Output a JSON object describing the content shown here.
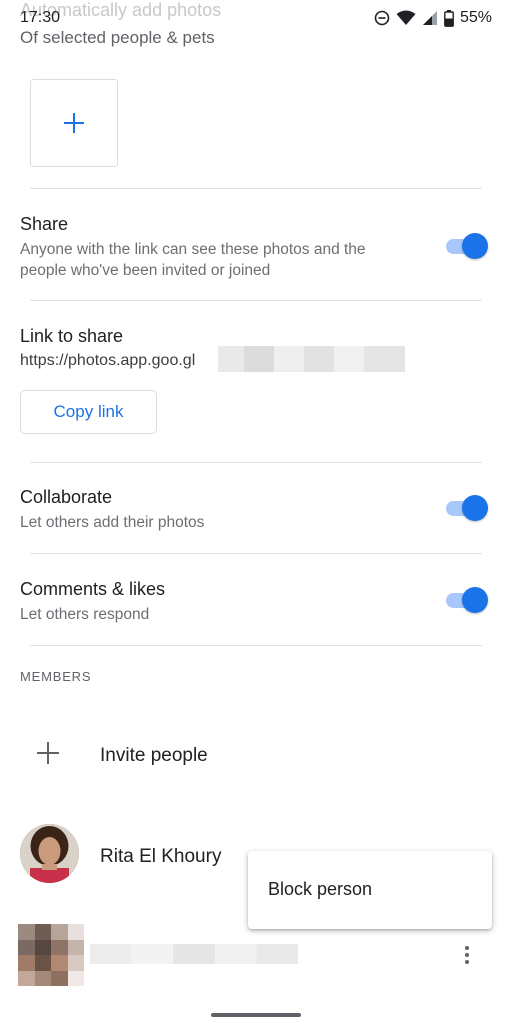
{
  "status_bar": {
    "time": "17:30",
    "battery": "55%"
  },
  "header": {
    "ghost_title": "Automatically add photos",
    "ghost_subtitle": "Of selected people & pets"
  },
  "share": {
    "title": "Share",
    "description": "Anyone with the link can see these photos and the people who've been invited or joined",
    "enabled": true
  },
  "link": {
    "title": "Link to share",
    "url": "https://photos.app.goo.gl",
    "copy_label": "Copy link"
  },
  "collaborate": {
    "title": "Collaborate",
    "description": "Let others add their photos",
    "enabled": true
  },
  "comments": {
    "title": "Comments & likes",
    "description": "Let others respond",
    "enabled": true
  },
  "members": {
    "section_label": "MEMBERS",
    "invite_label": "Invite people",
    "list": [
      {
        "name": "Rita El Khoury"
      }
    ]
  },
  "popup_menu": {
    "items": [
      "Block person"
    ]
  },
  "colors": {
    "accent": "#1a73e8",
    "toggle_track": "#a8c7fa"
  }
}
